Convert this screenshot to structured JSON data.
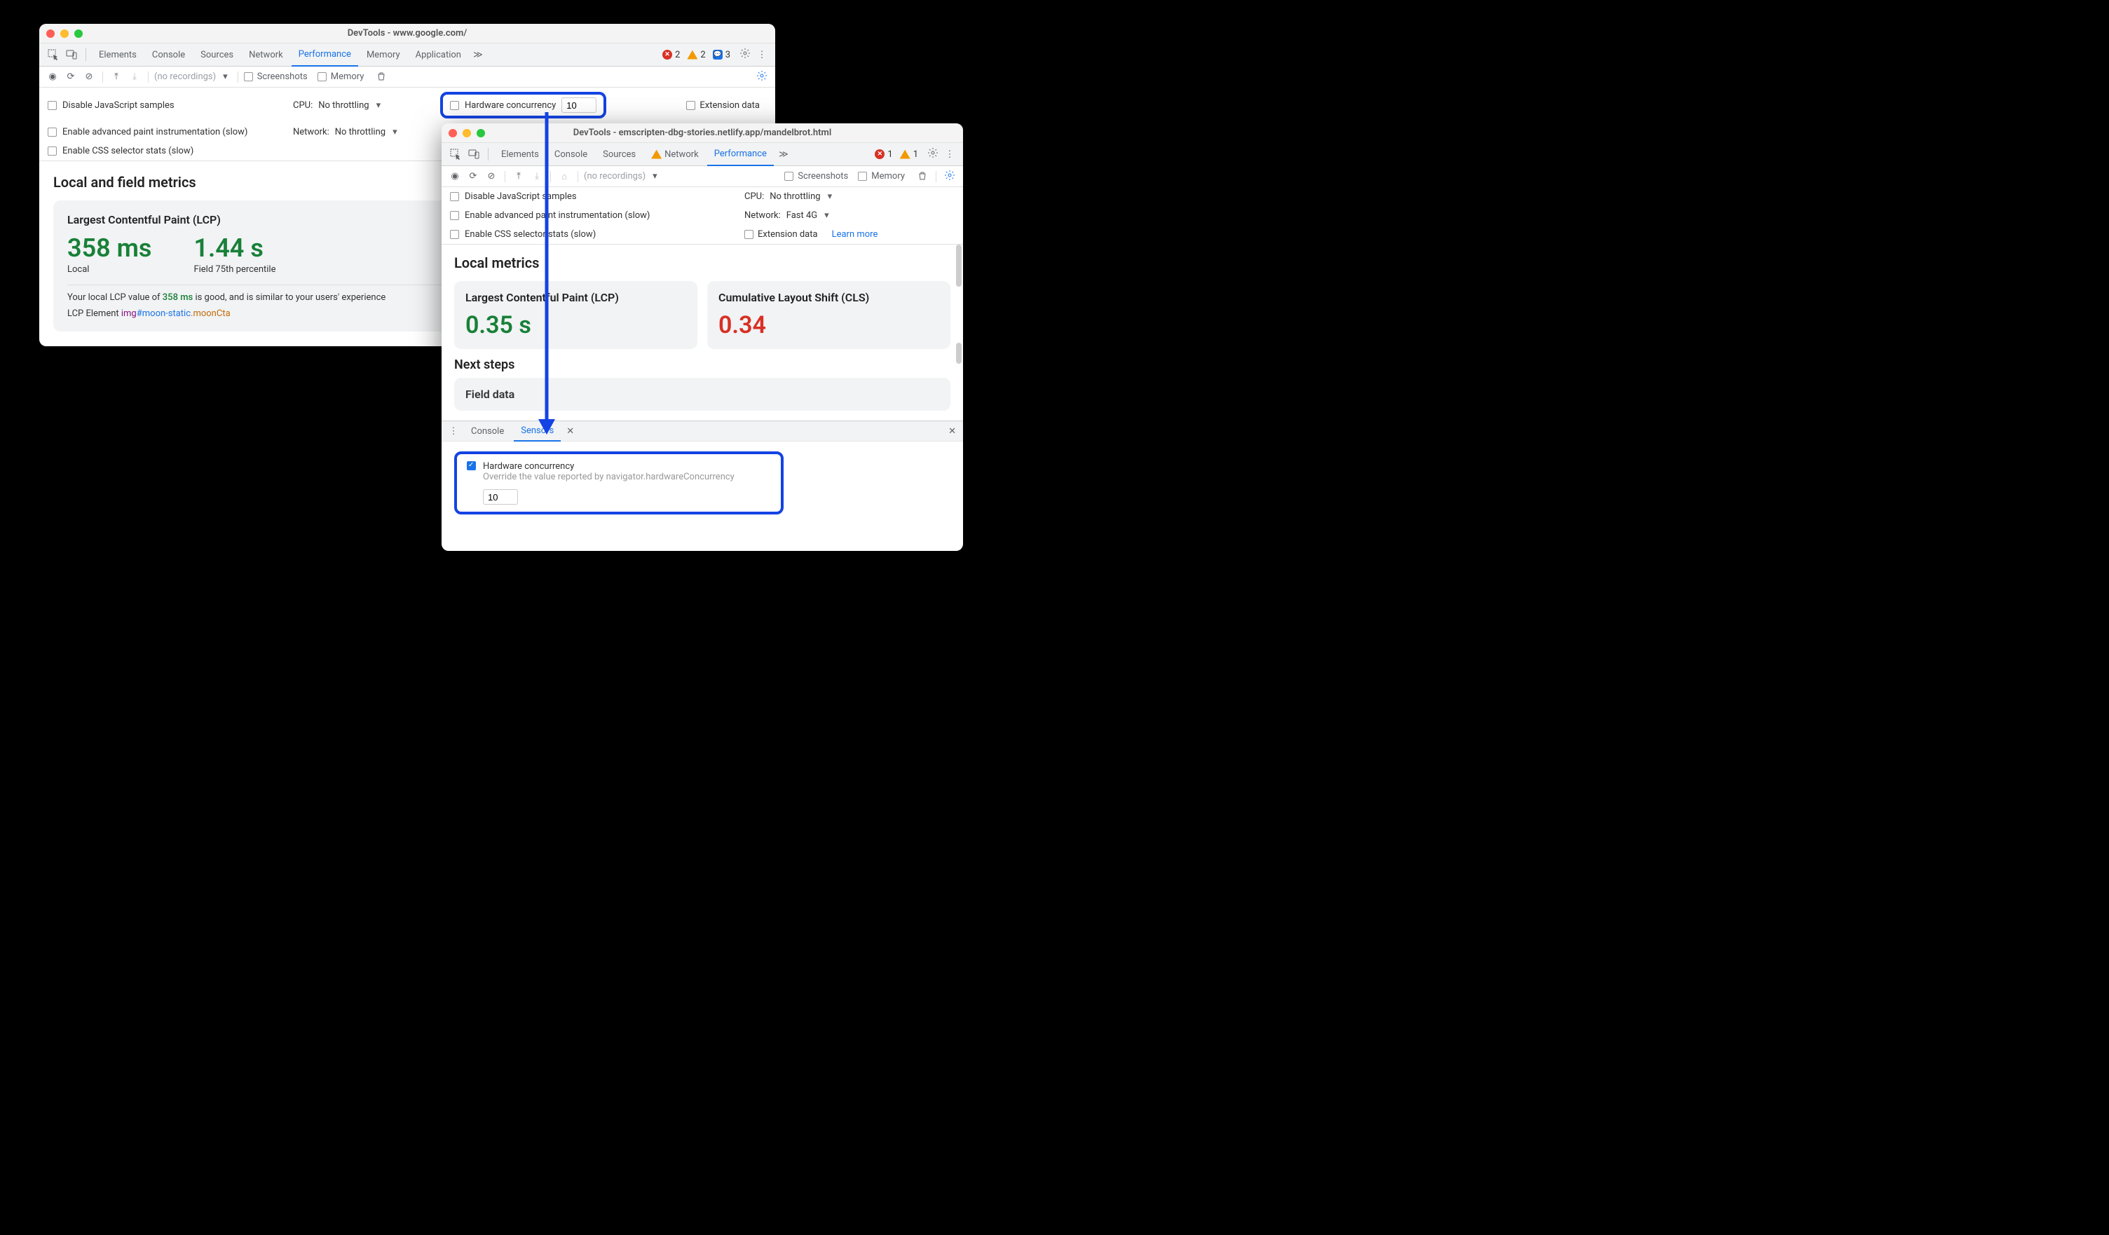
{
  "colors": {
    "accent": "#1a73e8",
    "good": "#188038",
    "bad": "#d93025",
    "highlight": "#1443e3"
  },
  "win1": {
    "title": "DevTools - www.google.com/",
    "tabs": [
      "Elements",
      "Console",
      "Sources",
      "Network",
      "Performance",
      "Memory",
      "Application"
    ],
    "active_tab": "Performance",
    "issues": {
      "errors": "2",
      "warnings": "2",
      "info": "3"
    },
    "toolbar": {
      "no_recordings": "(no recordings)",
      "screenshots": "Screenshots",
      "memory": "Memory"
    },
    "settings": {
      "disable_js": "Disable JavaScript samples",
      "paint_instr": "Enable advanced paint instrumentation (slow)",
      "css_stats": "Enable CSS selector stats (slow)",
      "cpu_label": "CPU:",
      "cpu_value": "No throttling",
      "network_label": "Network:",
      "network_value": "No throttling",
      "hw_label": "Hardware concurrency",
      "hw_value": "10",
      "ext_data": "Extension data"
    },
    "metrics_title": "Local and field metrics",
    "lcp": {
      "title": "Largest Contentful Paint (LCP)",
      "local_val": "358 ms",
      "local_label": "Local",
      "field_val": "1.44 s",
      "field_label": "Field 75th percentile",
      "desc_pre": "Your local LCP value of ",
      "desc_val": "358 ms",
      "desc_post": " is good, and is similar to your users' experience",
      "el_label": "LCP Element  ",
      "el_tag": "img",
      "el_id": "#moon-static",
      "el_cls": ".moonCta"
    }
  },
  "win2": {
    "title": "DevTools - emscripten-dbg-stories.netlify.app/mandelbrot.html",
    "tabs": [
      "Elements",
      "Console",
      "Sources",
      "Network",
      "Performance"
    ],
    "active_tab": "Performance",
    "network_tab_has_warning": true,
    "issues": {
      "errors": "1",
      "warnings": "1"
    },
    "toolbar": {
      "no_recordings": "(no recordings)",
      "screenshots": "Screenshots",
      "memory": "Memory"
    },
    "settings": {
      "disable_js": "Disable JavaScript samples",
      "paint_instr": "Enable advanced paint instrumentation (slow)",
      "css_stats": "Enable CSS selector stats (slow)",
      "cpu_label": "CPU:",
      "cpu_value": "No throttling",
      "network_label": "Network:",
      "network_value": "Fast 4G",
      "ext_data": "Extension data",
      "learn_more": "Learn more"
    },
    "metrics_title": "Local metrics",
    "lcp": {
      "title": "Largest Contentful Paint (LCP)",
      "val": "0.35 s"
    },
    "cls": {
      "title": "Cumulative Layout Shift (CLS)",
      "val": "0.34"
    },
    "next_steps": "Next steps",
    "field_data": "Field data",
    "drawer": {
      "tabs": [
        "Console",
        "Sensors"
      ],
      "active": "Sensors",
      "hw_label": "Hardware concurrency",
      "hw_desc": "Override the value reported by navigator.hardwareConcurrency",
      "hw_value": "10"
    }
  }
}
